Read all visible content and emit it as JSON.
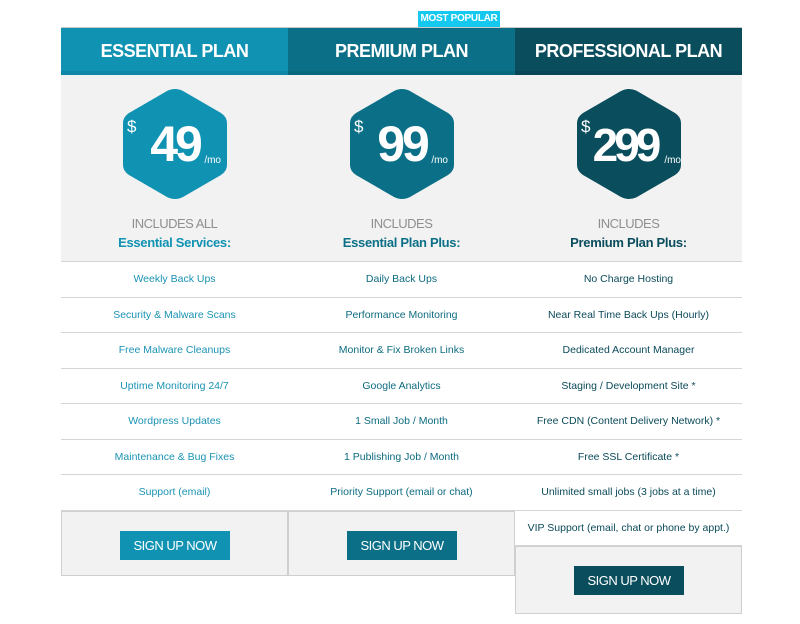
{
  "badge": "MOST POPULAR",
  "plans": [
    {
      "name": "ESSENTIAL PLAN",
      "currency": "$",
      "price": "49",
      "period": "/mo",
      "includes_label": "INCLUDES ALL",
      "includes_title": "Essential Services:",
      "color": "#1092b3",
      "features": [
        "Weekly Back Ups",
        "Security & Malware Scans",
        "Free Malware Cleanups",
        "Uptime Monitoring 24/7",
        "Wordpress Updates",
        "Maintenance & Bug Fixes",
        "Support (email)"
      ],
      "cta": "SIGN UP NOW"
    },
    {
      "name": "PREMIUM PLAN",
      "currency": "$",
      "price": "99",
      "period": "/mo",
      "includes_label": "INCLUDES",
      "includes_title": "Essential Plan Plus:",
      "color": "#0b7087",
      "features": [
        "Daily Back Ups",
        "Performance Monitoring",
        "Monitor & Fix Broken Links",
        "Google Analytics",
        "1 Small Job / Month",
        "1 Publishing Job / Month",
        "Priority Support (email or chat)"
      ],
      "cta": "SIGN UP NOW"
    },
    {
      "name": "PROFESSIONAL PLAN",
      "currency": "$",
      "price": "299",
      "period": "/mo",
      "includes_label": "INCLUDES",
      "includes_title": "Premium Plan Plus:",
      "color": "#0a4d5d",
      "features": [
        "No Charge Hosting",
        "Near Real Time Back Ups (Hourly)",
        "Dedicated Account Manager",
        "Staging / Development Site *",
        "Free CDN (Content Delivery Network) *",
        "Free SSL Certificate *",
        "Unlimited small jobs (3 jobs at a time)",
        "VIP Support (email, chat or phone by appt.)"
      ],
      "cta": "SIGN UP NOW"
    }
  ],
  "colors": {
    "badge": "#14c8ef",
    "panel_bg": "#f2f2f2"
  }
}
